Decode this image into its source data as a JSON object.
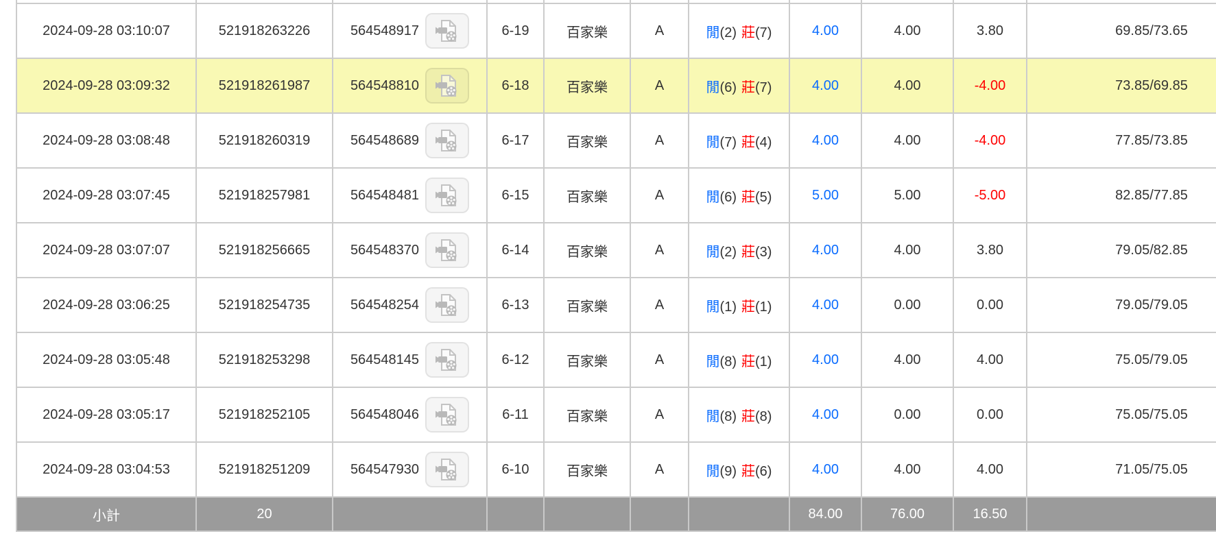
{
  "table": {
    "labels": {
      "player": "閒",
      "banker": "莊"
    },
    "rows": [
      {
        "time": "2024-09-28 03:10:07",
        "bet_id": "521918263226",
        "game_id": "564548917",
        "round": "6-19",
        "game": "百家樂",
        "table": "A",
        "player_score": "(2)",
        "banker_score": "(7)",
        "bet": "4.00",
        "valid": "4.00",
        "winloss": "3.80",
        "balance": "69.85/73.65",
        "highlighted": false
      },
      {
        "time": "2024-09-28 03:09:32",
        "bet_id": "521918261987",
        "game_id": "564548810",
        "round": "6-18",
        "game": "百家樂",
        "table": "A",
        "player_score": "(6)",
        "banker_score": "(7)",
        "bet": "4.00",
        "valid": "4.00",
        "winloss": "-4.00",
        "balance": "73.85/69.85",
        "highlighted": true
      },
      {
        "time": "2024-09-28 03:08:48",
        "bet_id": "521918260319",
        "game_id": "564548689",
        "round": "6-17",
        "game": "百家樂",
        "table": "A",
        "player_score": "(7)",
        "banker_score": "(4)",
        "bet": "4.00",
        "valid": "4.00",
        "winloss": "-4.00",
        "balance": "77.85/73.85",
        "highlighted": false
      },
      {
        "time": "2024-09-28 03:07:45",
        "bet_id": "521918257981",
        "game_id": "564548481",
        "round": "6-15",
        "game": "百家樂",
        "table": "A",
        "player_score": "(6)",
        "banker_score": "(5)",
        "bet": "5.00",
        "valid": "5.00",
        "winloss": "-5.00",
        "balance": "82.85/77.85",
        "highlighted": false
      },
      {
        "time": "2024-09-28 03:07:07",
        "bet_id": "521918256665",
        "game_id": "564548370",
        "round": "6-14",
        "game": "百家樂",
        "table": "A",
        "player_score": "(2)",
        "banker_score": "(3)",
        "bet": "4.00",
        "valid": "4.00",
        "winloss": "3.80",
        "balance": "79.05/82.85",
        "highlighted": false
      },
      {
        "time": "2024-09-28 03:06:25",
        "bet_id": "521918254735",
        "game_id": "564548254",
        "round": "6-13",
        "game": "百家樂",
        "table": "A",
        "player_score": "(1)",
        "banker_score": "(1)",
        "bet": "4.00",
        "valid": "0.00",
        "winloss": "0.00",
        "balance": "79.05/79.05",
        "highlighted": false
      },
      {
        "time": "2024-09-28 03:05:48",
        "bet_id": "521918253298",
        "game_id": "564548145",
        "round": "6-12",
        "game": "百家樂",
        "table": "A",
        "player_score": "(8)",
        "banker_score": "(1)",
        "bet": "4.00",
        "valid": "4.00",
        "winloss": "4.00",
        "balance": "75.05/79.05",
        "highlighted": false
      },
      {
        "time": "2024-09-28 03:05:17",
        "bet_id": "521918252105",
        "game_id": "564548046",
        "round": "6-11",
        "game": "百家樂",
        "table": "A",
        "player_score": "(8)",
        "banker_score": "(8)",
        "bet": "4.00",
        "valid": "0.00",
        "winloss": "0.00",
        "balance": "75.05/75.05",
        "highlighted": false
      },
      {
        "time": "2024-09-28 03:04:53",
        "bet_id": "521918251209",
        "game_id": "564547930",
        "round": "6-10",
        "game": "百家樂",
        "table": "A",
        "player_score": "(9)",
        "banker_score": "(6)",
        "bet": "4.00",
        "valid": "4.00",
        "winloss": "4.00",
        "balance": "71.05/75.05",
        "highlighted": false
      }
    ],
    "footer": {
      "label": "小計",
      "count": "20",
      "bet_total": "84.00",
      "valid_total": "76.00",
      "winloss_total": "16.50"
    }
  },
  "icons": {
    "video": "video-file-icon"
  },
  "colors": {
    "highlight_yellow": "#f9f9b4",
    "footer_gray": "#9b9b9b",
    "bet_blue": "#0a6cff",
    "loss_red": "#ff0000",
    "border_gray": "#cccccc",
    "text": "#333333"
  }
}
